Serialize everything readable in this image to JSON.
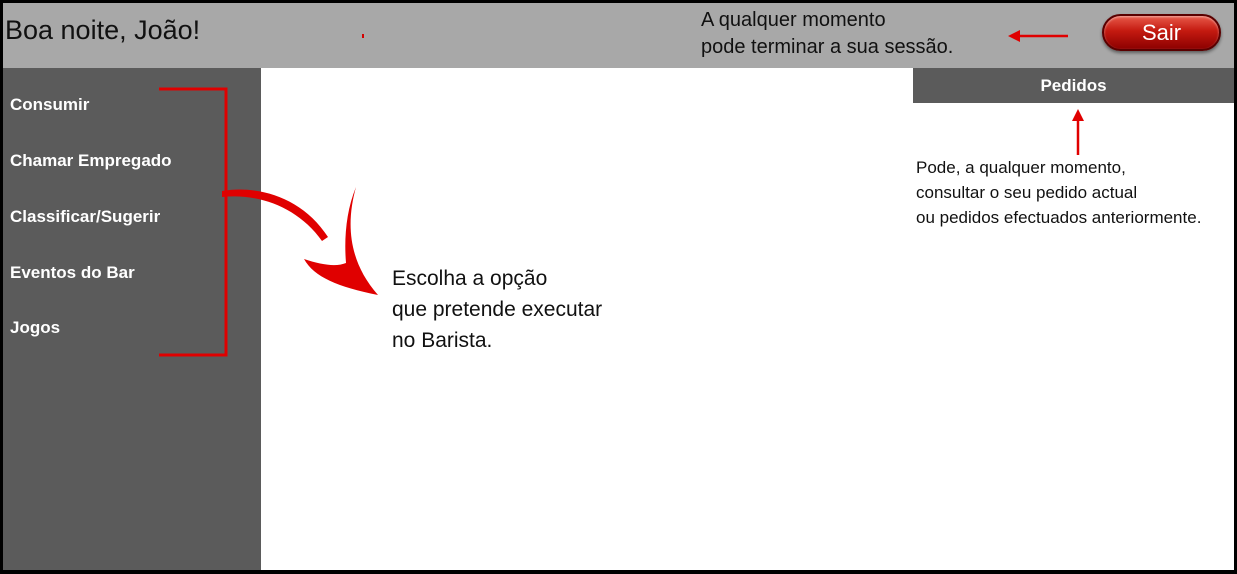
{
  "header": {
    "greeting": "Boa noite, João!",
    "logout_label": "Sair",
    "session_note": [
      "A qualquer momento",
      "pode terminar a sua sessão."
    ]
  },
  "sidebar": {
    "items": [
      {
        "label": "Consumir"
      },
      {
        "label": "Chamar Empregado"
      },
      {
        "label": "Classificar/Sugerir"
      },
      {
        "label": "Eventos do Bar"
      },
      {
        "label": "Jogos"
      }
    ]
  },
  "orders": {
    "header_label": "Pedidos",
    "note": [
      "Pode, a qualquer momento,",
      "consultar o seu pedido actual",
      "ou pedidos efectuados anteriormente."
    ]
  },
  "main": {
    "menu_note": [
      "Escolha a opção",
      "que pretende executar",
      "no Barista."
    ]
  },
  "colors": {
    "topbar": "#a8a8a8",
    "sidebar": "#5b5b5b",
    "annotation_red": "#e00000",
    "button_red": "#c41a10"
  },
  "icons": {
    "session_arrow": "left-arrow-icon",
    "orders_arrow": "up-arrow-icon",
    "menu_arrow": "curved-arrow-icon",
    "bracket": "bracket-icon"
  }
}
